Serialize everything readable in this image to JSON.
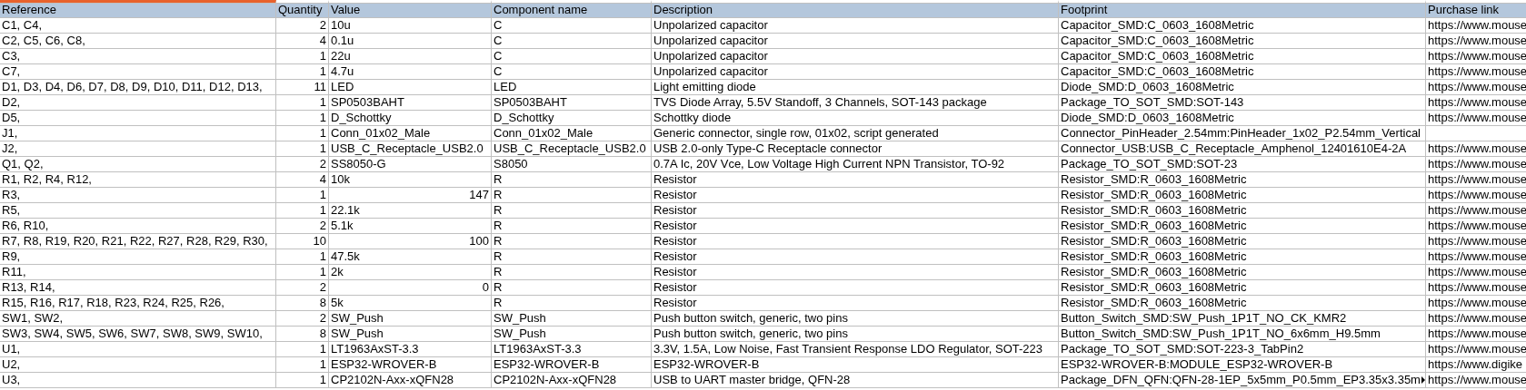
{
  "sheet": {
    "columns": [
      {
        "label": "Reference",
        "selected": true
      },
      {
        "label": "Quantity",
        "selected": false
      },
      {
        "label": "Value",
        "selected": false
      },
      {
        "label": "Component name",
        "selected": false
      },
      {
        "label": "Description",
        "selected": false
      },
      {
        "label": "Footprint",
        "selected": false
      },
      {
        "label": "Purchase link",
        "selected": false
      }
    ],
    "rows": [
      {
        "reference": "C1, C4,",
        "quantity": "2",
        "value": {
          "text": "10u",
          "kind": "text"
        },
        "component": "C",
        "description": "Unpolarized capacitor",
        "footprint": "Capacitor_SMD:C_0603_1608Metric",
        "link": "https://www.mouse"
      },
      {
        "reference": "C2, C5, C6, C8,",
        "quantity": "4",
        "value": {
          "text": "0.1u",
          "kind": "text"
        },
        "component": "C",
        "description": "Unpolarized capacitor",
        "footprint": "Capacitor_SMD:C_0603_1608Metric",
        "link": "https://www.mouse"
      },
      {
        "reference": "C3,",
        "quantity": "1",
        "value": {
          "text": "22u",
          "kind": "text"
        },
        "component": "C",
        "description": "Unpolarized capacitor",
        "footprint": "Capacitor_SMD:C_0603_1608Metric",
        "link": "https://www.mouse"
      },
      {
        "reference": "C7,",
        "quantity": "1",
        "value": {
          "text": "4.7u",
          "kind": "text"
        },
        "component": "C",
        "description": "Unpolarized capacitor",
        "footprint": "Capacitor_SMD:C_0603_1608Metric",
        "link": "https://www.mouse"
      },
      {
        "reference": "D1, D3, D4, D6, D7, D8, D9, D10, D11, D12, D13,",
        "quantity": "11",
        "value": {
          "text": "LED",
          "kind": "text"
        },
        "component": "LED",
        "description": "Light emitting diode",
        "footprint": "Diode_SMD:D_0603_1608Metric",
        "link": "https://www.mouse"
      },
      {
        "reference": "D2,",
        "quantity": "1",
        "value": {
          "text": "SP0503BAHT",
          "kind": "text"
        },
        "component": "SP0503BAHT",
        "description": "TVS Diode Array, 5.5V Standoff, 3 Channels, SOT-143 package",
        "footprint": "Package_TO_SOT_SMD:SOT-143",
        "link": "https://www.mouse"
      },
      {
        "reference": "D5,",
        "quantity": "1",
        "value": {
          "text": "D_Schottky",
          "kind": "text"
        },
        "component": "D_Schottky",
        "description": "Schottky diode",
        "footprint": "Diode_SMD:D_0603_1608Metric",
        "link": "https://www.mouse"
      },
      {
        "reference": "J1,",
        "quantity": "1",
        "value": {
          "text": "Conn_01x02_Male",
          "kind": "text"
        },
        "component": "Conn_01x02_Male",
        "description": "Generic connector, single row, 01x02, script generated",
        "footprint": "Connector_PinHeader_2.54mm:PinHeader_1x02_P2.54mm_Vertical"
      },
      {
        "reference": "J2,",
        "quantity": "1",
        "value": {
          "text": "USB_C_Receptacle_USB2.0",
          "kind": "text"
        },
        "component": "USB_C_Receptacle_USB2.0",
        "description": "USB 2.0-only Type-C Receptacle connector",
        "footprint": "Connector_USB:USB_C_Receptacle_Amphenol_12401610E4-2A",
        "link": "https://www.mouse"
      },
      {
        "reference": "Q1, Q2,",
        "quantity": "2",
        "value": {
          "text": "SS8050-G",
          "kind": "text"
        },
        "component": "S8050",
        "description": "0.7A Ic, 20V Vce, Low Voltage High Current NPN Transistor, TO-92",
        "footprint": "Package_TO_SOT_SMD:SOT-23",
        "link": "https://www.mouse"
      },
      {
        "reference": "R1, R2, R4, R12,",
        "quantity": "4",
        "value": {
          "text": "10k",
          "kind": "text"
        },
        "component": "R",
        "description": "Resistor",
        "footprint": "Resistor_SMD:R_0603_1608Metric",
        "link": "https://www.mouse"
      },
      {
        "reference": "R3,",
        "quantity": "1",
        "value": {
          "text": "147",
          "kind": "number"
        },
        "component": "R",
        "description": "Resistor",
        "footprint": "Resistor_SMD:R_0603_1608Metric",
        "link": "https://www.mouse"
      },
      {
        "reference": "R5,",
        "quantity": "1",
        "value": {
          "text": "22.1k",
          "kind": "text"
        },
        "component": "R",
        "description": "Resistor",
        "footprint": "Resistor_SMD:R_0603_1608Metric",
        "link": "https://www.mouse"
      },
      {
        "reference": "R6, R10,",
        "quantity": "2",
        "value": {
          "text": "5.1k",
          "kind": "text"
        },
        "component": "R",
        "description": "Resistor",
        "footprint": "Resistor_SMD:R_0603_1608Metric",
        "link": "https://www.mouse"
      },
      {
        "reference": "R7, R8, R19, R20, R21, R22, R27, R28, R29, R30,",
        "quantity": "10",
        "value": {
          "text": "100",
          "kind": "number"
        },
        "component": "R",
        "description": "Resistor",
        "footprint": "Resistor_SMD:R_0603_1608Metric",
        "link": "https://www.mouse"
      },
      {
        "reference": "R9,",
        "quantity": "1",
        "value": {
          "text": "47.5k",
          "kind": "text"
        },
        "component": "R",
        "description": "Resistor",
        "footprint": "Resistor_SMD:R_0603_1608Metric",
        "link": "https://www.mouse"
      },
      {
        "reference": "R11,",
        "quantity": "1",
        "value": {
          "text": "2k",
          "kind": "text"
        },
        "component": "R",
        "description": "Resistor",
        "footprint": "Resistor_SMD:R_0603_1608Metric",
        "link": "https://www.mouse"
      },
      {
        "reference": "R13, R14,",
        "quantity": "2",
        "value": {
          "text": "0",
          "kind": "number"
        },
        "component": "R",
        "description": "Resistor",
        "footprint": "Resistor_SMD:R_0603_1608Metric",
        "link": "https://www.mouse"
      },
      {
        "reference": "R15, R16, R17, R18, R23, R24, R25, R26,",
        "quantity": "8",
        "value": {
          "text": "5k",
          "kind": "text"
        },
        "component": "R",
        "description": "Resistor",
        "footprint": "Resistor_SMD:R_0603_1608Metric",
        "link": "https://www.mouse"
      },
      {
        "reference": "SW1, SW2,",
        "quantity": "2",
        "value": {
          "text": "SW_Push",
          "kind": "text"
        },
        "component": "SW_Push",
        "description": "Push button switch, generic, two pins",
        "footprint": "Button_Switch_SMD:SW_Push_1P1T_NO_CK_KMR2",
        "link": "https://www.mouse"
      },
      {
        "reference": "SW3, SW4, SW5, SW6, SW7, SW8, SW9, SW10,",
        "quantity": "8",
        "value": {
          "text": "SW_Push",
          "kind": "text"
        },
        "component": "SW_Push",
        "description": "Push button switch, generic, two pins",
        "footprint": "Button_Switch_SMD:SW_Push_1P1T_NO_6x6mm_H9.5mm",
        "link": "https://www.mouse"
      },
      {
        "reference": "U1,",
        "quantity": "1",
        "value": {
          "text": "LT1963AxST-3.3",
          "kind": "text"
        },
        "component": "LT1963AxST-3.3",
        "description": "3.3V, 1.5A, Low Noise, Fast Transient Response LDO Regulator, SOT-223",
        "footprint": "Package_TO_SOT_SMD:SOT-223-3_TabPin2",
        "link": "https://www.mouse"
      },
      {
        "reference": "U2,",
        "quantity": "1",
        "value": {
          "text": "ESP32-WROVER-B",
          "kind": "text"
        },
        "component": "ESP32-WROVER-B",
        "description": "ESP32-WROVER-B",
        "footprint": "ESP32-WROVER-B:MODULE_ESP32-WROVER-B",
        "link": "https://www.digike"
      },
      {
        "reference": "U3,",
        "quantity": "1",
        "value": {
          "text": "CP2102N-Axx-xQFN28",
          "kind": "text"
        },
        "component": "CP2102N-Axx-xQFN28",
        "description": "USB to UART master bridge, QFN-28",
        "footprint": "Package_DFN_QFN:QFN-28-1EP_5x5mm_P0.5mm_EP3.35x3.35m",
        "footprint_overflow": true,
        "link": "https://www.mouse"
      }
    ]
  }
}
